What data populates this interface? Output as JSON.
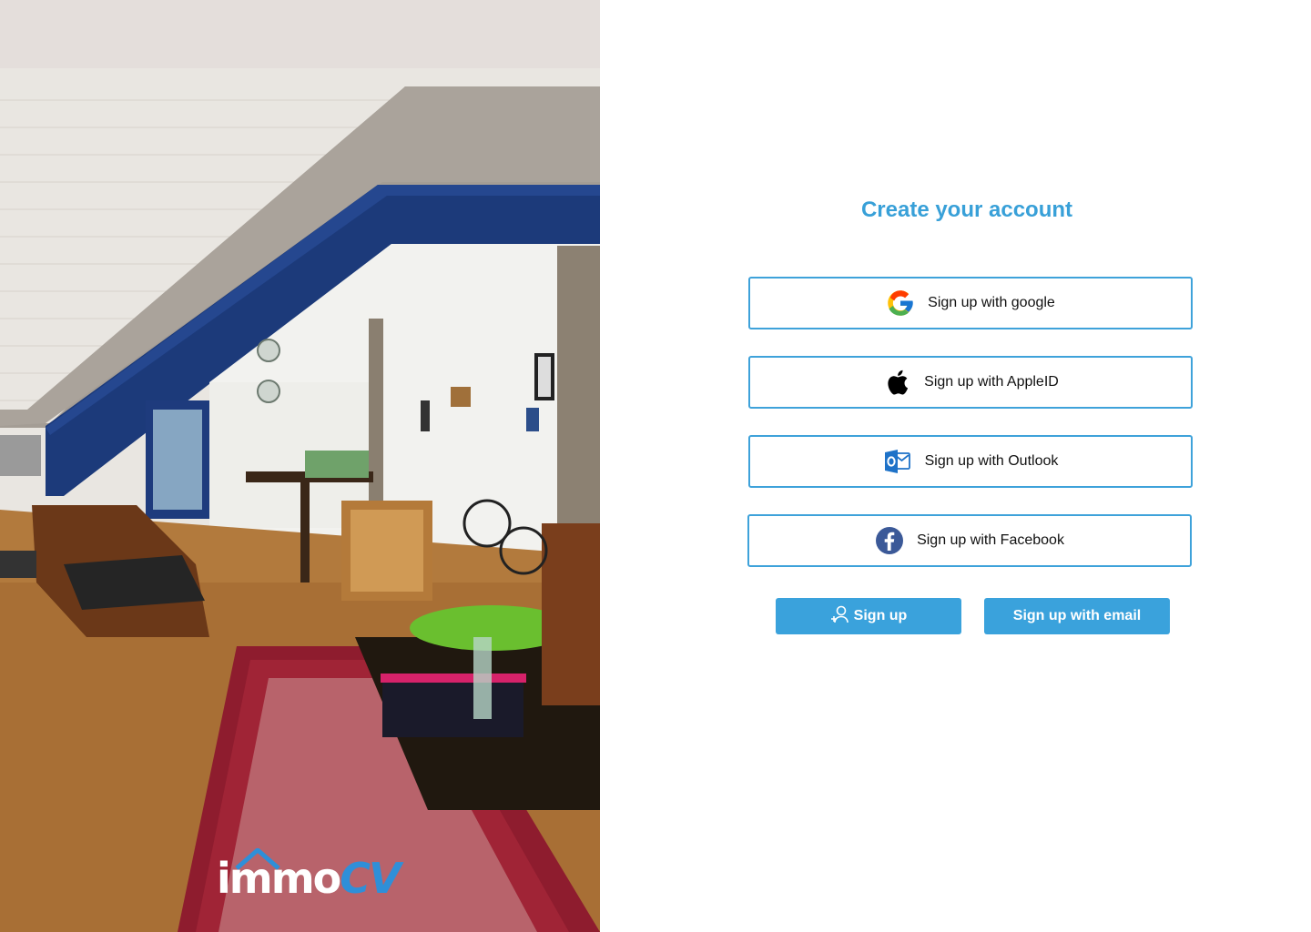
{
  "brand": {
    "logo_text_main": "immo",
    "logo_text_accent": "CV",
    "accent_color": "#38a0d8"
  },
  "form": {
    "title": "Create your account",
    "providers": [
      {
        "label": "Sign up with google",
        "icon": "google-icon"
      },
      {
        "label": "Sign up with AppleID",
        "icon": "apple-icon"
      },
      {
        "label": "Sign up with Outlook",
        "icon": "outlook-icon"
      },
      {
        "label": "Sign up with Facebook",
        "icon": "facebook-icon"
      }
    ],
    "actions": {
      "signup_label": "Sign up",
      "signup_icon": "user-plus-icon",
      "email_label": "Sign up with email"
    }
  }
}
